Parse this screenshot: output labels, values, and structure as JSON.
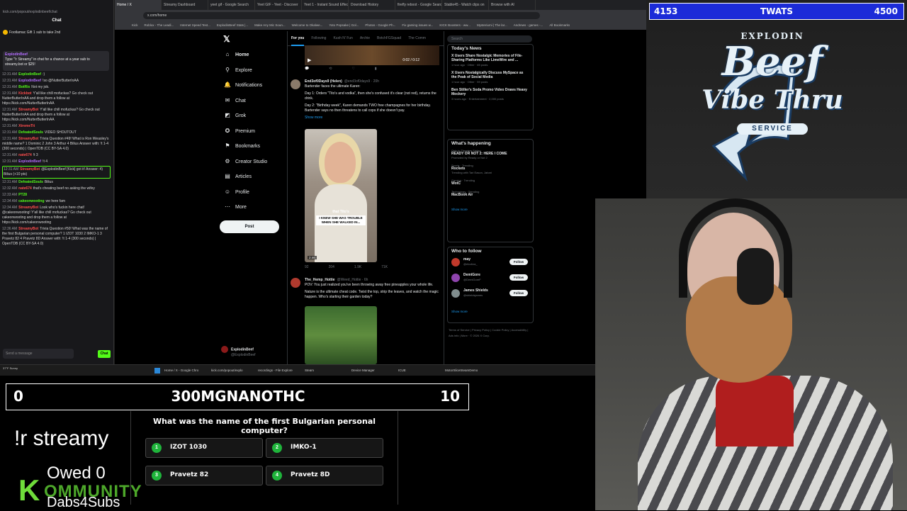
{
  "chat": {
    "url": "kick.com/popout/explodinbeef/chat",
    "header": "Chat",
    "pinned": "Footlamac   Gift 1 sub to take 2nd",
    "announce_user": "ExplodinBeef",
    "announce_text": "Type \"!r Streamy\" in chat for a chance at a year sub to streamy.bot or $25!",
    "messages": [
      {
        "time": "12:31 AM",
        "user": "ExplodinBeef",
        "color": "#53fc18",
        "text": ":)"
      },
      {
        "time": "12:31 AM",
        "user": "ExplodinBeef",
        "color": "#b36cff",
        "text": "!so @NutterButterInAA"
      },
      {
        "time": "12:31 AM",
        "user": "BotRix",
        "color": "#53fc18",
        "text": "Not my job."
      },
      {
        "time": "12:31 AM",
        "user": "Kickbot",
        "color": "#ff4d4d",
        "text": "Y'all like chill mofuckas? Go check out NutterButterInAA and drop them a follow at https://kick.com/NutterButterInAA"
      },
      {
        "time": "12:31 AM",
        "user": "StreamyBot",
        "color": "#ff4d4d",
        "text": "Y'all like chill mofuckas? Go check out NutterButterInAA and drop them a follow at https://kick.com/NutterButterInAA"
      },
      {
        "time": "12:31 AM",
        "user": "XtremeTit",
        "color": "#ff4d4d",
        "text": ""
      },
      {
        "time": "12:31 AM",
        "user": "DefeatedSouls",
        "color": "#53fc18",
        "text": "VIDEO SHOUTOUT"
      },
      {
        "time": "12:31 AM",
        "user": "StreamyBot",
        "color": "#ff4d4d",
        "text": "Trivia Question #49! What is Ron Weasley's middle name? 1 Dominic 2 John 3 Arthur 4 Bilius Answer with: !t 1-4 (300 seconds) | OpenTDB (CC BY-SA 4.0)"
      },
      {
        "time": "12:31 AM",
        "user": "nate674",
        "color": "#ff4d4d",
        "text": "!t 3"
      },
      {
        "time": "12:31 AM",
        "user": "ExplodinBeef",
        "color": "#b36cff",
        "text": "!t 4"
      },
      {
        "time": "12:31 AM",
        "user": "StreamyBot",
        "color": "#ff4d4d",
        "text": "@ExplodinBeef [Kick] got it! Answer: 4) Bilius (+10 pts)"
      },
      {
        "time": "12:31 AM",
        "user": "DefeatedSouls",
        "color": "#53fc18",
        "text": "Bilius"
      },
      {
        "time": "12:32 AM",
        "user": "nate674",
        "color": "#ff4d4d",
        "text": "that's cheating beef no asking the wifey"
      },
      {
        "time": "12:33 AM",
        "user": "PT28",
        "color": "#53fc18",
        "text": ""
      },
      {
        "time": "12:34 AM",
        "user": "cakeonwooting",
        "color": "#53fc18",
        "text": "we here fam"
      },
      {
        "time": "12:34 AM",
        "user": "StreamyBot",
        "color": "#ff4d4d",
        "text": "Look who's fuckin here chat! @cakeonwooting! Y'all like chill mofuckas? Go check out cakeonwooting and drop them a follow at https://kick.com/cakeonwooting"
      },
      {
        "time": "12:36 AM",
        "user": "StreamyBot",
        "color": "#ff4d4d",
        "text": "Trivia Question #50! What was the name of the first Bulgarian personal computer? 1 IZOT 1030 2 IMKO-1 3 Pravetz 82 4 Pravetz 8D Answer with: !t 1-4 (300 seconds) | OpenTDB (CC BY-SA 4.0)"
      }
    ],
    "input_placeholder": "Send a message",
    "send_label": "Chat"
  },
  "browser": {
    "tabs": [
      "Home / X",
      "Streamy Dashboard",
      "yeet gif - Google Search",
      "Yeet GIF - Yeet - Discover",
      "Yeet 1 - Instant Sound Effect",
      "Download History",
      "firefly reboot - Google Search",
      "Stable45 - Watch clips on",
      "Browse with AI"
    ],
    "url": "x.com/home",
    "bookmarks": [
      "Kick",
      "Roblox - The Leadi...",
      "Internet Speed Test...",
      "ExplodinBeef Stats |...",
      "Make Any Mic Soun...",
      "Welcome to Okalwe...",
      "Yoto Popsake | Gol...",
      "Photos - Google Ph...",
      "Fix gaming issues w...",
      "KICK Boosters - ww...",
      "Mysteriumi | The lar...",
      "Andrews - games -...",
      "All Bookmarks"
    ]
  },
  "x_nav": {
    "items": [
      {
        "label": "Home",
        "icon": "home-icon",
        "glyph": "⌂"
      },
      {
        "label": "Explore",
        "icon": "search-icon",
        "glyph": "⚲"
      },
      {
        "label": "Notifications",
        "icon": "bell-icon",
        "glyph": "🔔"
      },
      {
        "label": "Chat",
        "icon": "chat-icon",
        "glyph": "✉"
      },
      {
        "label": "Grok",
        "icon": "grok-icon",
        "glyph": "◩"
      },
      {
        "label": "Premium",
        "icon": "premium-icon",
        "glyph": "✪"
      },
      {
        "label": "Bookmarks",
        "icon": "bookmark-icon",
        "glyph": "⚑"
      },
      {
        "label": "Creator Studio",
        "icon": "creator-icon",
        "glyph": "⚙"
      },
      {
        "label": "Articles",
        "icon": "articles-icon",
        "glyph": "▤"
      },
      {
        "label": "Profile",
        "icon": "profile-icon",
        "glyph": "☺"
      },
      {
        "label": "More",
        "icon": "more-icon",
        "glyph": "⋯"
      }
    ],
    "post_label": "Post",
    "profile_name": "ExplodinBeef",
    "profile_handle": "@ExplodinBeef"
  },
  "timeline": {
    "tabs": [
      "For you",
      "Following",
      "Kush N' Fun",
      "Archie",
      "BotchFGSquad",
      "The Comm"
    ],
    "video1_time": "0:02 / 0:12",
    "tweet1": {
      "author": "End3of0Days9 (Helen)",
      "handle": "@end3of0days9 · 20h",
      "lines": [
        "Bartender faces the ultimate Karen:",
        "Day 1: Orders \"Tito's and vodka\", then she's confused it's clear (not red), returns the drink.",
        "Day 2: \"Birthday week\", Karen demands TWO free champagnes for her birthday. Bartender says no then threatens to call cops if she doesn't pay."
      ],
      "show_more": "Show more",
      "caption_top": "that Tito's",
      "caption_box": "I KNEW SHE WAS TROUBLE WHEN SHE WALKED IN...",
      "duration": "2:46",
      "stats": [
        "92",
        "204",
        "1.9K",
        "71K"
      ]
    },
    "tweet2": {
      "author": "The_Hemp_Hottie",
      "handle": "@Weed_Hottie · 6h",
      "lines": [
        "POV: You just realized you've been throwing away free pineapples your whole life.",
        "Nature is the ultimate cheat code. Twist the top, strip the leaves, and watch the magic happen. Who's starting their garden today?"
      ]
    }
  },
  "sidebar": {
    "search_placeholder": "Search",
    "news_title": "Today's News",
    "news": [
      {
        "title": "X Users Share Nostalgic Memories of File-Sharing Platforms Like LimeWire and ...",
        "meta": "1 hour ago · Other · 65 posts"
      },
      {
        "title": "X Users Nostalgically Discuss MySpace as the Peak of Social Media",
        "meta": "1 hour ago · Other · 59 posts"
      },
      {
        "title": "Ben Stiller's Soda Promo Video Draws Heavy Mockery",
        "meta": "3 hours ago · Entertainment · 2,000 posts"
      }
    ],
    "happening_title": "What's happening",
    "trends": [
      {
        "context": "Only in Theaters Friday",
        "name": "READY OR NOT 2: HERE I COME",
        "extra": "Promoted by Ready or Not 2"
      },
      {
        "context": "Sports · Trending",
        "name": "Rockets",
        "extra": "Trending with Tari Eason, Jabari"
      },
      {
        "context": "Gaming · Trending",
        "name": "WotC",
        "extra": ""
      },
      {
        "context": "Technology · Trending",
        "name": "MacBook Air",
        "extra": ""
      }
    ],
    "show_more": "Show more",
    "follow_title": "Who to follow",
    "follow": [
      {
        "name": "may",
        "handle": "@elcoliza_",
        "color": "#c0392b"
      },
      {
        "name": "DemiGore",
        "handle": "@DemiGoreF",
        "color": "#8e44ad"
      },
      {
        "name": "James Shields",
        "handle": "@shieldsjames",
        "color": "#7f8c8d"
      }
    ],
    "follow_label": "Follow",
    "footer": "Terms of Service | Privacy Policy | Cookie Policy | Accessibility | Ads info | More · © 2026 X Corp."
  },
  "taskbar": {
    "weather": "37°F Sunny",
    "items": [
      "Home / X - Google Chro",
      "kick.com/popout/explo",
      "recordings - File Explore",
      "Steam",
      "Device Manager",
      "ICUE",
      "MotorSliceSteamDemo"
    ]
  },
  "trivia": {
    "score_left": "0",
    "title": "300MGNANOTHC",
    "score_right": "10",
    "question": "What was the name of the first Bulgarian personal computer?",
    "answers": [
      {
        "num": "1",
        "text": "IZOT 1030"
      },
      {
        "num": "2",
        "text": "IMKO-1"
      },
      {
        "num": "3",
        "text": "Pravetz 82"
      },
      {
        "num": "4",
        "text": "Pravetz 8D"
      }
    ],
    "command": "!r streamy",
    "owed": "Owed 0",
    "kommunity_k": "K",
    "kommunity_rest": "OMMUNITY",
    "dabs": "Dabs4Subs"
  },
  "counter": {
    "left": "4153",
    "mid": "TWATS",
    "right": "4500"
  },
  "logo": {
    "explodin": "EXPLODIN",
    "beef": "Beef",
    "vibe": "Vibe Thru",
    "service": "SERVICE"
  }
}
